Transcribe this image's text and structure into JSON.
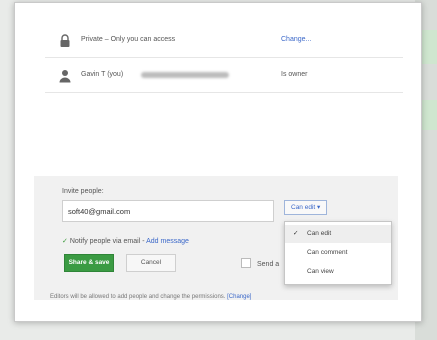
{
  "permissions": {
    "private_row": {
      "text": "Private – Only you can access",
      "action": "Change..."
    },
    "owner_row": {
      "name": "Gavin T (you)",
      "role": "Is owner"
    }
  },
  "invite": {
    "label": "Invite people:",
    "email_value": "soft40@gmail.com",
    "permission_button": "Can edit ▾",
    "notify_check": "✓",
    "notify_text": "Notify people via email - ",
    "add_message": "Add message",
    "share_button": "Share & save",
    "cancel_button": "Cancel",
    "send_copy_partial": "Send a",
    "footnote_text": "Editors will be allowed to add people and change the permissions. ",
    "footnote_link": "[Change]"
  },
  "dropdown": {
    "items": [
      {
        "label": "Can edit",
        "check": "✓",
        "selected": true
      },
      {
        "label": "Can comment",
        "check": "",
        "selected": false
      },
      {
        "label": "Can view",
        "check": "",
        "selected": false
      }
    ]
  },
  "colors": {
    "share_green": "#3b9b43",
    "link_blue": "#3b68c9",
    "invite_panel": "#f1f1f1"
  }
}
